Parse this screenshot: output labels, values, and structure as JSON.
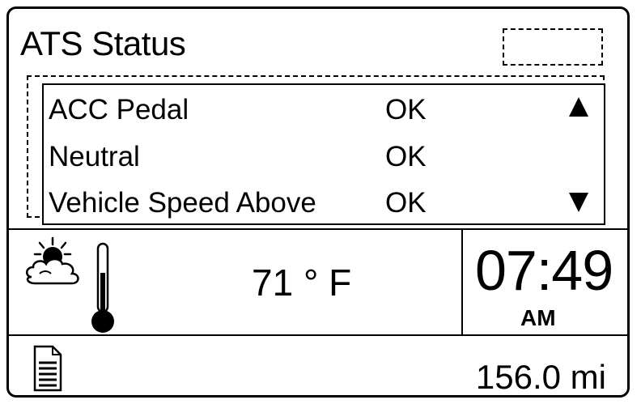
{
  "screen": {
    "title": "ATS Status"
  },
  "status_list": {
    "rows": [
      {
        "label": "ACC Pedal",
        "status": "OK"
      },
      {
        "label": "Neutral",
        "status": "OK"
      },
      {
        "label": "Vehicle Speed Above",
        "status": "OK"
      }
    ],
    "scroll_up_icon": "triangle-up",
    "scroll_down_icon": "triangle-down"
  },
  "environment": {
    "weather_icon": "sun-behind-cloud",
    "thermometer_icon": "thermometer",
    "temperature": "71 ° F"
  },
  "clock": {
    "time": "07:49",
    "period": "AM"
  },
  "footer": {
    "document_icon": "document",
    "odometer": "156.0 mi"
  }
}
